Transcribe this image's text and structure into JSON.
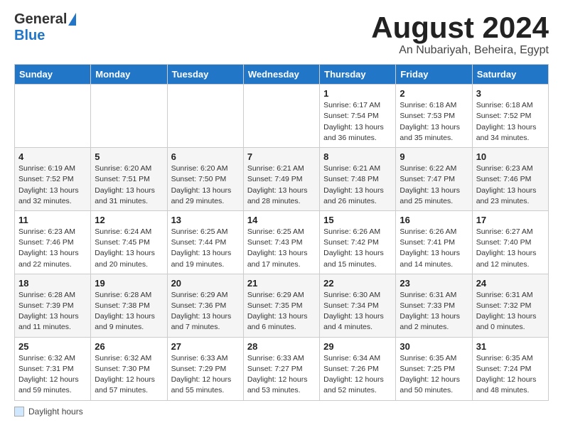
{
  "logo": {
    "general": "General",
    "blue": "Blue"
  },
  "title": "August 2024",
  "subtitle": "An Nubariyah, Beheira, Egypt",
  "weekdays": [
    "Sunday",
    "Monday",
    "Tuesday",
    "Wednesday",
    "Thursday",
    "Friday",
    "Saturday"
  ],
  "footer": {
    "label": "Daylight hours"
  },
  "weeks": [
    [
      {
        "day": "",
        "info": ""
      },
      {
        "day": "",
        "info": ""
      },
      {
        "day": "",
        "info": ""
      },
      {
        "day": "",
        "info": ""
      },
      {
        "day": "1",
        "info": "Sunrise: 6:17 AM\nSunset: 7:54 PM\nDaylight: 13 hours and 36 minutes."
      },
      {
        "day": "2",
        "info": "Sunrise: 6:18 AM\nSunset: 7:53 PM\nDaylight: 13 hours and 35 minutes."
      },
      {
        "day": "3",
        "info": "Sunrise: 6:18 AM\nSunset: 7:52 PM\nDaylight: 13 hours and 34 minutes."
      }
    ],
    [
      {
        "day": "4",
        "info": "Sunrise: 6:19 AM\nSunset: 7:52 PM\nDaylight: 13 hours and 32 minutes."
      },
      {
        "day": "5",
        "info": "Sunrise: 6:20 AM\nSunset: 7:51 PM\nDaylight: 13 hours and 31 minutes."
      },
      {
        "day": "6",
        "info": "Sunrise: 6:20 AM\nSunset: 7:50 PM\nDaylight: 13 hours and 29 minutes."
      },
      {
        "day": "7",
        "info": "Sunrise: 6:21 AM\nSunset: 7:49 PM\nDaylight: 13 hours and 28 minutes."
      },
      {
        "day": "8",
        "info": "Sunrise: 6:21 AM\nSunset: 7:48 PM\nDaylight: 13 hours and 26 minutes."
      },
      {
        "day": "9",
        "info": "Sunrise: 6:22 AM\nSunset: 7:47 PM\nDaylight: 13 hours and 25 minutes."
      },
      {
        "day": "10",
        "info": "Sunrise: 6:23 AM\nSunset: 7:46 PM\nDaylight: 13 hours and 23 minutes."
      }
    ],
    [
      {
        "day": "11",
        "info": "Sunrise: 6:23 AM\nSunset: 7:46 PM\nDaylight: 13 hours and 22 minutes."
      },
      {
        "day": "12",
        "info": "Sunrise: 6:24 AM\nSunset: 7:45 PM\nDaylight: 13 hours and 20 minutes."
      },
      {
        "day": "13",
        "info": "Sunrise: 6:25 AM\nSunset: 7:44 PM\nDaylight: 13 hours and 19 minutes."
      },
      {
        "day": "14",
        "info": "Sunrise: 6:25 AM\nSunset: 7:43 PM\nDaylight: 13 hours and 17 minutes."
      },
      {
        "day": "15",
        "info": "Sunrise: 6:26 AM\nSunset: 7:42 PM\nDaylight: 13 hours and 15 minutes."
      },
      {
        "day": "16",
        "info": "Sunrise: 6:26 AM\nSunset: 7:41 PM\nDaylight: 13 hours and 14 minutes."
      },
      {
        "day": "17",
        "info": "Sunrise: 6:27 AM\nSunset: 7:40 PM\nDaylight: 13 hours and 12 minutes."
      }
    ],
    [
      {
        "day": "18",
        "info": "Sunrise: 6:28 AM\nSunset: 7:39 PM\nDaylight: 13 hours and 11 minutes."
      },
      {
        "day": "19",
        "info": "Sunrise: 6:28 AM\nSunset: 7:38 PM\nDaylight: 13 hours and 9 minutes."
      },
      {
        "day": "20",
        "info": "Sunrise: 6:29 AM\nSunset: 7:36 PM\nDaylight: 13 hours and 7 minutes."
      },
      {
        "day": "21",
        "info": "Sunrise: 6:29 AM\nSunset: 7:35 PM\nDaylight: 13 hours and 6 minutes."
      },
      {
        "day": "22",
        "info": "Sunrise: 6:30 AM\nSunset: 7:34 PM\nDaylight: 13 hours and 4 minutes."
      },
      {
        "day": "23",
        "info": "Sunrise: 6:31 AM\nSunset: 7:33 PM\nDaylight: 13 hours and 2 minutes."
      },
      {
        "day": "24",
        "info": "Sunrise: 6:31 AM\nSunset: 7:32 PM\nDaylight: 13 hours and 0 minutes."
      }
    ],
    [
      {
        "day": "25",
        "info": "Sunrise: 6:32 AM\nSunset: 7:31 PM\nDaylight: 12 hours and 59 minutes."
      },
      {
        "day": "26",
        "info": "Sunrise: 6:32 AM\nSunset: 7:30 PM\nDaylight: 12 hours and 57 minutes."
      },
      {
        "day": "27",
        "info": "Sunrise: 6:33 AM\nSunset: 7:29 PM\nDaylight: 12 hours and 55 minutes."
      },
      {
        "day": "28",
        "info": "Sunrise: 6:33 AM\nSunset: 7:27 PM\nDaylight: 12 hours and 53 minutes."
      },
      {
        "day": "29",
        "info": "Sunrise: 6:34 AM\nSunset: 7:26 PM\nDaylight: 12 hours and 52 minutes."
      },
      {
        "day": "30",
        "info": "Sunrise: 6:35 AM\nSunset: 7:25 PM\nDaylight: 12 hours and 50 minutes."
      },
      {
        "day": "31",
        "info": "Sunrise: 6:35 AM\nSunset: 7:24 PM\nDaylight: 12 hours and 48 minutes."
      }
    ]
  ]
}
